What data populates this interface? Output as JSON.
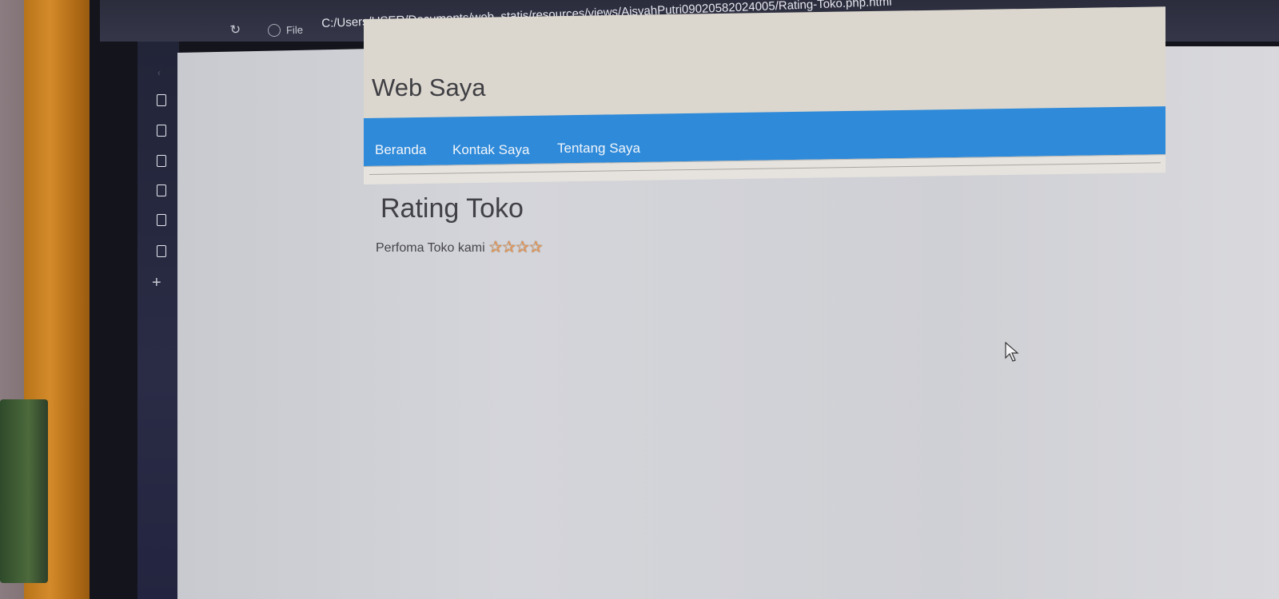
{
  "browser": {
    "address_label": "File",
    "url": "C:/Users/USER/Documents/web_statis/resources/views/AisyahPutri09020582024005/Rating-Toko.php.html"
  },
  "sidebar": {
    "items": [
      {
        "icon": "page-icon"
      },
      {
        "icon": "page-icon"
      },
      {
        "icon": "page-icon"
      },
      {
        "icon": "page-icon"
      },
      {
        "icon": "page-icon"
      },
      {
        "icon": "page-icon"
      }
    ],
    "add_icon": "plus-icon",
    "add_glyph": "+"
  },
  "site": {
    "title": "Web Saya",
    "nav": [
      "Beranda",
      "Kontak Saya",
      "Tentang Saya"
    ],
    "accent_color": "#2f8ad9"
  },
  "content": {
    "heading": "Rating Toko",
    "rating_text": "Perfoma Toko kami",
    "stars": 4,
    "star_glyph": "✰"
  }
}
